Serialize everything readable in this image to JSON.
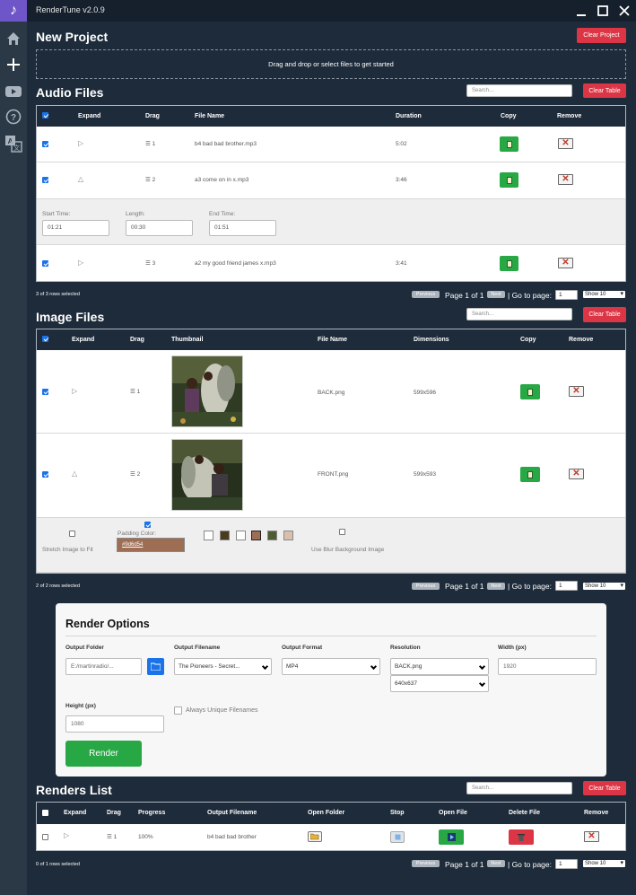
{
  "app": {
    "title": "RenderTune v2.0.9"
  },
  "project": {
    "title": "New Project",
    "clear_label": "Clear Project",
    "dropzone": "Drag and drop or select files to get started"
  },
  "audio": {
    "title": "Audio Files",
    "search_placeholder": "Search...",
    "clear_label": "Clear Table",
    "columns": [
      "Expand",
      "Drag",
      "File Name",
      "Duration",
      "Copy",
      "Remove"
    ],
    "rows": [
      {
        "index": "1",
        "name": "b4 bad bad brother.mp3",
        "duration": "5:02"
      },
      {
        "index": "2",
        "name": "a3 come on in x.mp3",
        "duration": "3:46"
      },
      {
        "index": "3",
        "name": "a2 my good friend james x.mp3",
        "duration": "3:41"
      }
    ],
    "expanded": {
      "start_label": "Start Time:",
      "start": "01:21",
      "length_label": "Length:",
      "length": "00:30",
      "end_label": "End Time:",
      "end": "01:51"
    },
    "selected": "3 of 3 rows selected"
  },
  "images": {
    "title": "Image Files",
    "search_placeholder": "Search...",
    "clear_label": "Clear Table",
    "columns": [
      "Expand",
      "Drag",
      "Thumbnail",
      "File Name",
      "Dimensions",
      "Copy",
      "Remove"
    ],
    "rows": [
      {
        "index": "1",
        "name": "BACK.png",
        "dimensions": "599x596"
      },
      {
        "index": "2",
        "name": "FRONT.png",
        "dimensions": "599x593"
      }
    ],
    "expanded": {
      "stretch_label": "Stretch Image to Fit",
      "padding_label": "Padding Color:",
      "padding_value": "#9d6d54",
      "blur_label": "Use Blur Background Image"
    },
    "swatches": [
      "#ffffff",
      "#4a3c1f",
      "#ffffff",
      "#9d6d54",
      "#4e5c34",
      "#d9bfae"
    ],
    "selected": "2 of 2 rows selected"
  },
  "pagination": {
    "previous": "Previous",
    "next": "Next",
    "page_info": "Page 1 of 1",
    "goto_label": "| Go to page:",
    "goto_value": "1",
    "show": "Show 10"
  },
  "render_options": {
    "title": "Render Options",
    "output_folder_label": "Output Folder",
    "output_folder": "E:/martinradio/...",
    "output_filename_label": "Output Filename",
    "output_filename": "The Pioneers - Secret...",
    "output_format_label": "Output Format",
    "output_format": "MP4",
    "resolution_label": "Resolution",
    "resolution_image": "BACK.png",
    "resolution_size": "640x637",
    "width_label": "Width (px)",
    "width": "1920",
    "height_label": "Height (px)",
    "height": "1080",
    "unique_label": "Always Unique Filenames",
    "render_label": "Render"
  },
  "renders": {
    "title": "Renders List",
    "search_placeholder": "Search...",
    "clear_label": "Clear Table",
    "columns": [
      "Expand",
      "Drag",
      "Progress",
      "Output Filename",
      "Open Folder",
      "Stop",
      "Open File",
      "Delete File",
      "Remove"
    ],
    "rows": [
      {
        "index": "1",
        "progress": "100%",
        "filename": "b4 bad bad brother"
      }
    ],
    "selected": "0 of 1 rows selected"
  },
  "colors": {
    "background": "#1e2b3a",
    "sidebar": "#2b3947",
    "accent": "#6f56c8",
    "danger": "#dc3545",
    "success": "#28a745",
    "primary": "#1a73e8"
  }
}
